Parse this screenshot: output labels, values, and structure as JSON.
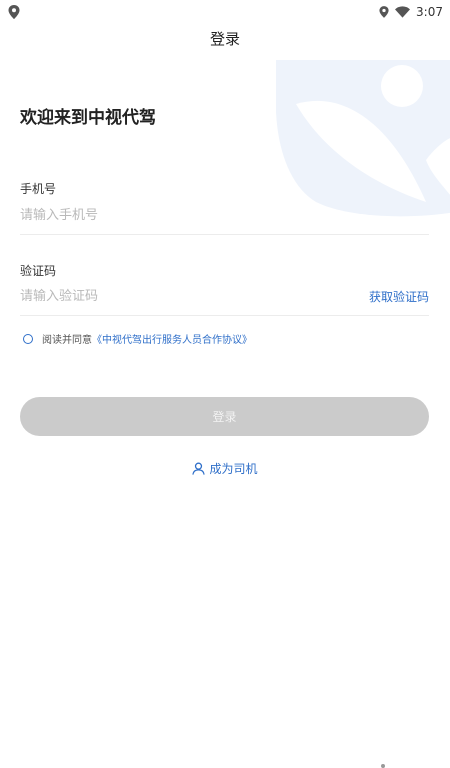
{
  "status_bar": {
    "time": "3:07",
    "icons": [
      "location-icon",
      "wifi-icon"
    ]
  },
  "header": {
    "title": "登录"
  },
  "welcome_text": "欢迎来到中视代驾",
  "phone": {
    "label": "手机号",
    "placeholder": "请输入手机号",
    "value": ""
  },
  "code": {
    "label": "验证码",
    "placeholder": "请输入验证码",
    "value": "",
    "get_code_label": "获取验证码"
  },
  "agreement": {
    "checked": false,
    "prefix": "阅读并同意",
    "link_text": "《中视代驾出行服务人员合作协议》"
  },
  "login_button": {
    "label": "登录",
    "enabled": false
  },
  "become_driver": {
    "label": "成为司机"
  },
  "colors": {
    "accent": "#2f6fc9",
    "button_disabled": "#cbcbcb",
    "watermark": "#eef3fb"
  }
}
